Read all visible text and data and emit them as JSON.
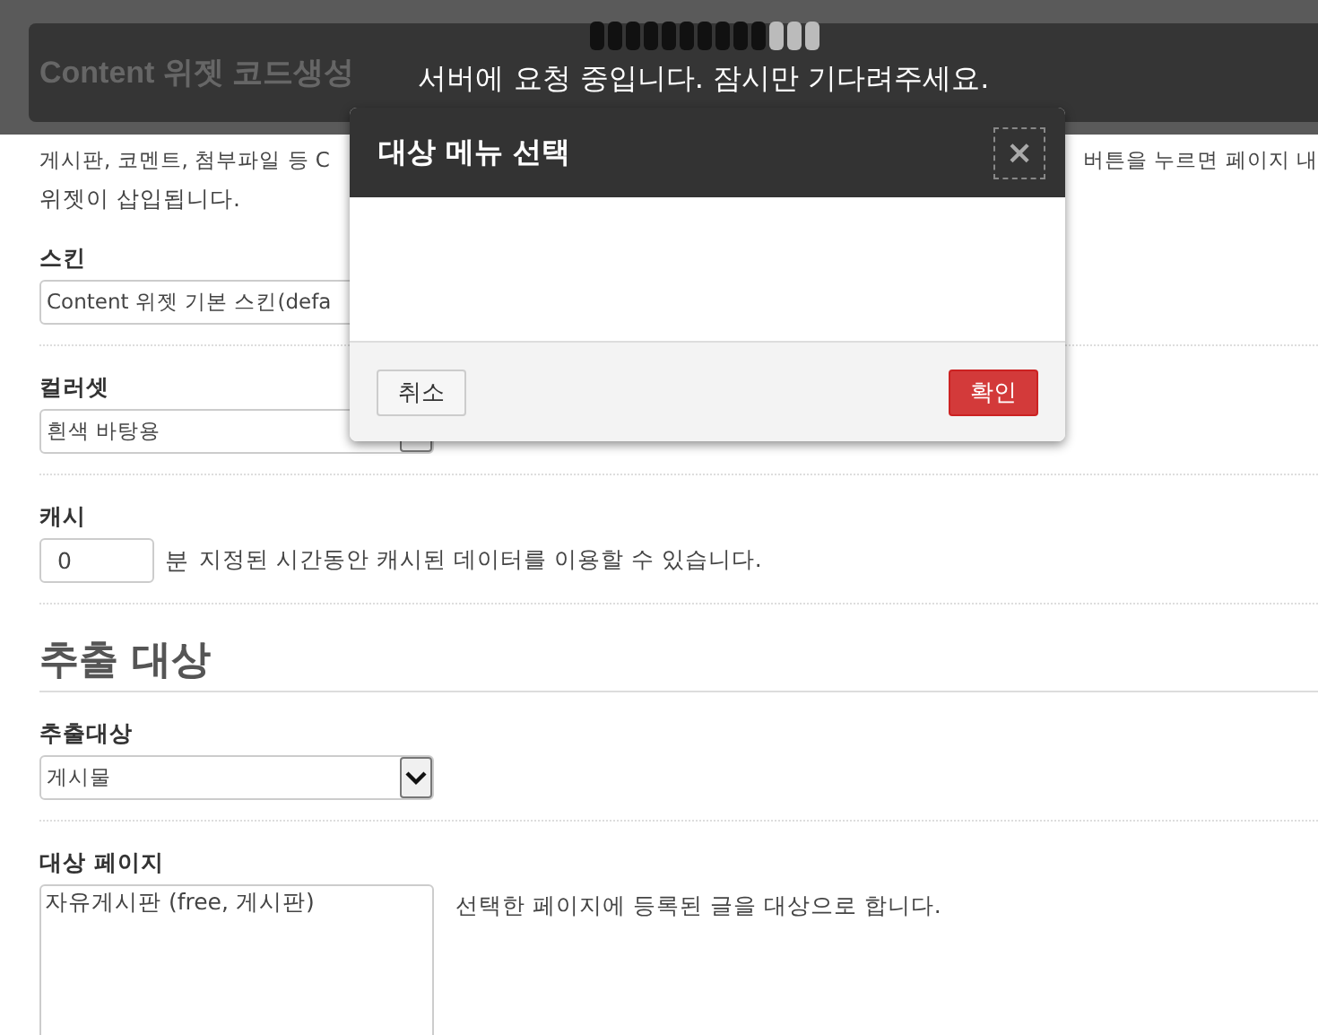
{
  "header": {
    "title": "Content 위젯 코드생성"
  },
  "loading": {
    "message": "서버에 요청 중입니다. 잠시만 기다려주세요."
  },
  "intro": {
    "left_text": "게시판, 코멘트, 첨부파일 등 C",
    "right_text": "버튼을 누르면 페이지 내",
    "second_line": "위젯이 삽입됩니다."
  },
  "fields": [
    {
      "kind": "select",
      "label": "스킨",
      "value": "Content 위젯 기본 스킨(defa"
    },
    {
      "kind": "select",
      "label": "컬러셋",
      "value": "흰색 바탕용"
    },
    {
      "kind": "number",
      "label": "캐시",
      "value": "0",
      "unit": "분",
      "help": "지정된 시간동안 캐시된 데이터를 이용할 수 있습니다."
    }
  ],
  "section": {
    "title": "추출 대상"
  },
  "section_fields": [
    {
      "kind": "select",
      "label": "추출대상",
      "value": "게시물"
    },
    {
      "kind": "list",
      "label": "대상 페이지",
      "items": [
        "자유게시판 (free, 게시판)"
      ],
      "help": "선택한 페이지에 등록된 글을 대상으로 합니다."
    }
  ],
  "modal": {
    "title": "대상 메뉴 선택",
    "close": "×",
    "buttons": [
      {
        "label": "취소",
        "kind": "default"
      },
      {
        "label": "확인",
        "kind": "primary"
      }
    ]
  }
}
